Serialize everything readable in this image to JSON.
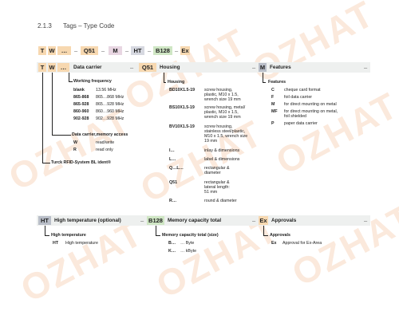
{
  "heading": {
    "number": "2.1.3",
    "title": "Tags – Type Code"
  },
  "code_row": {
    "boxes": [
      "T",
      "W",
      "…",
      "Q51",
      "M",
      "HT",
      "B128",
      "Ex"
    ],
    "dash": "–"
  },
  "bar1": {
    "t": "T",
    "w": "W",
    "ellipsis": "…",
    "data_carrier": "Data carrier",
    "dash": "–",
    "q51": "Q51",
    "housing": "Housing",
    "m": "M",
    "features": "Features"
  },
  "working_frequency": {
    "title": "Working frequency",
    "rows": [
      {
        "code": "blank",
        "value": "13.56 MHz"
      },
      {
        "code": "865-868",
        "value": "865…868 MHz"
      },
      {
        "code": "865-928",
        "value": "865…928 MHz"
      },
      {
        "code": "860-960",
        "value": "860…960 MHz"
      },
      {
        "code": "902-928",
        "value": "902…928 MHz"
      }
    ]
  },
  "data_carrier_access": {
    "title": "Data carrier,memory access",
    "rows": [
      {
        "code": "W",
        "value": "read/write"
      },
      {
        "code": "R",
        "value": "read only"
      }
    ]
  },
  "system_label": "Turck RFID-System BL ident®",
  "housing": {
    "title": "Housing",
    "rows": [
      {
        "code": "BD10X1.5-19",
        "lines": [
          "screw housing,",
          "plastic, M10 x 1.5,",
          "wrench size 19 mm"
        ]
      },
      {
        "code": "BS10X1.5-19",
        "lines": [
          "screw housing, metal/",
          "plastic, M10 x 1.5,",
          "wrench size 19 mm"
        ]
      },
      {
        "code": "BV10X1.5-19",
        "lines": [
          "screw housing,",
          "stainless steel/plastic,",
          "M10 x 1.5, wrench size",
          "19 mm"
        ]
      },
      {
        "code": "I…",
        "lines": [
          "inlay & dimensions"
        ]
      },
      {
        "code": "L…",
        "lines": [
          "label & dimensions"
        ]
      },
      {
        "code": "Q…L…",
        "lines": [
          "rectangular &",
          "diameter"
        ]
      },
      {
        "code": "Q51",
        "lines": [
          "rectangular &",
          "lateral length:",
          "51 mm"
        ]
      },
      {
        "code": "R…",
        "lines": [
          "round & diameter"
        ]
      }
    ]
  },
  "features": {
    "title": "Features",
    "rows": [
      {
        "code": "C",
        "lines": [
          "cheque card format"
        ]
      },
      {
        "code": "F",
        "lines": [
          "foil data carrier"
        ]
      },
      {
        "code": "M",
        "lines": [
          "for direct mounting on metal"
        ]
      },
      {
        "code": "MF",
        "lines": [
          "for direct mounting on metal,",
          "foil shielded"
        ]
      },
      {
        "code": "P",
        "lines": [
          "paper data carrier"
        ]
      }
    ]
  },
  "bar2": {
    "ht": "HT",
    "high_temp": "High temperature (optional)",
    "dash": "–",
    "b128": "B128",
    "memory": "Memory capacity total",
    "ex": "Ex",
    "approvals": "Approvals"
  },
  "high_temperature": {
    "title": "High temperature",
    "rows": [
      {
        "code": "HT",
        "value": "High temperature"
      }
    ]
  },
  "memory_capacity": {
    "title": "Memory capacity total (size)",
    "rows": [
      {
        "code": "B…",
        "value": "… Byte"
      },
      {
        "code": "K…",
        "value": "… kByte"
      }
    ]
  },
  "approvals": {
    "title": "Approvals",
    "rows": [
      {
        "code": "Ex",
        "value": "Approval for Ex-Area"
      }
    ]
  },
  "watermark": "OZHAT",
  "colors": {
    "orange_box": "#f7d8b0",
    "green_box": "#cfe6c4",
    "pink_box": "#e8d6e2",
    "grey_box": "#d6d8e0",
    "bar_bg": "#eef0ef",
    "dark_box": "#b9bec8"
  }
}
